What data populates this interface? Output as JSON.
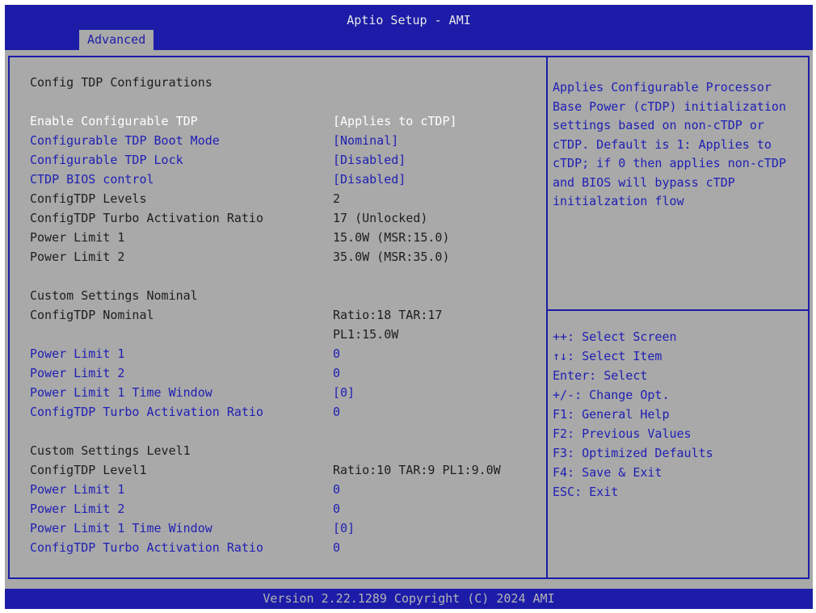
{
  "header": {
    "title": "Aptio Setup - AMI",
    "tab": "Advanced"
  },
  "main": {
    "section_title": "Config TDP Configurations",
    "rows": [
      {
        "label": "Enable Configurable TDP",
        "value": "[Applies to cTDP]",
        "state": "selected"
      },
      {
        "label": "Configurable TDP Boot Mode",
        "value": "[Nominal]",
        "state": "link"
      },
      {
        "label": "Configurable TDP Lock",
        "value": "[Disabled]",
        "state": "link"
      },
      {
        "label": "CTDP BIOS control",
        "value": "[Disabled]",
        "state": "link"
      },
      {
        "label": "ConfigTDP Levels",
        "value": "2",
        "state": "static"
      },
      {
        "label": "ConfigTDP Turbo Activation Ratio",
        "value": "17 (Unlocked)",
        "state": "static"
      },
      {
        "label": "Power Limit 1",
        "value": "15.0W (MSR:15.0)",
        "state": "static"
      },
      {
        "label": "Power Limit 2",
        "value": "35.0W (MSR:35.0)",
        "state": "static"
      }
    ],
    "nominal": {
      "title": "Custom Settings Nominal",
      "info_label": "ConfigTDP Nominal",
      "info_value_line1": "Ratio:18 TAR:17",
      "info_value_line2": "PL1:15.0W",
      "rows": [
        {
          "label": "Power Limit 1",
          "value": "0"
        },
        {
          "label": "Power Limit 2",
          "value": "0"
        },
        {
          "label": "Power Limit 1 Time Window",
          "value": "[0]"
        },
        {
          "label": "ConfigTDP Turbo Activation Ratio",
          "value": "0"
        }
      ]
    },
    "level1": {
      "title": "Custom Settings Level1",
      "info_label": "ConfigTDP Level1",
      "info_value": "Ratio:10 TAR:9 PL1:9.0W",
      "rows": [
        {
          "label": "Power Limit 1",
          "value": "0"
        },
        {
          "label": "Power Limit 2",
          "value": "0"
        },
        {
          "label": "Power Limit 1 Time Window",
          "value": "[0]"
        },
        {
          "label": "ConfigTDP Turbo Activation Ratio",
          "value": "0"
        }
      ]
    }
  },
  "help_text": "Applies Configurable Processor Base Power (cTDP) initialization settings based on non-cTDP or cTDP. Default is 1: Applies to cTDP; if 0 then applies non-cTDP and BIOS will bypass cTDP initialzation flow",
  "keys": [
    "++: Select Screen",
    "↑↓: Select Item",
    "Enter: Select",
    "+/-: Change Opt.",
    "F1: General Help",
    "F2: Previous Values",
    "F3: Optimized Defaults",
    "F4: Save & Exit",
    "ESC: Exit"
  ],
  "footer": {
    "version": "Version 2.22.1289 Copyright (C) 2024 AMI"
  },
  "colors": {
    "blue": "#1c1ca8",
    "panel": "#a9a9a9",
    "link": "#2020b4",
    "selected": "#ffffff",
    "static": "#1e1e1e"
  }
}
